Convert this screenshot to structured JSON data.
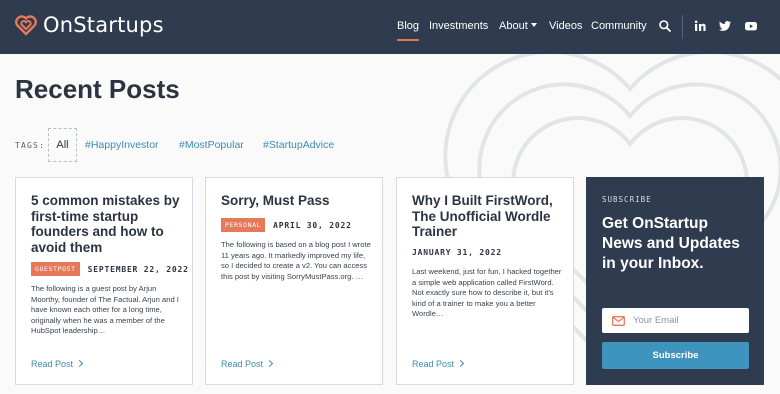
{
  "brand": {
    "name": "OnStartups",
    "accent": "#e07a52"
  },
  "nav": {
    "items": [
      {
        "label": "Blog",
        "active": true
      },
      {
        "label": "Investments",
        "active": false
      },
      {
        "label": "About",
        "active": false,
        "dropdown": true
      },
      {
        "label": "Videos",
        "active": false
      },
      {
        "label": "Community",
        "active": false
      }
    ],
    "icons": [
      "search-icon",
      "linkedin-icon",
      "twitter-icon",
      "youtube-icon"
    ]
  },
  "page": {
    "title": "Recent Posts"
  },
  "tags": {
    "label": "TAGS:",
    "items": [
      "All",
      "#HappyInvestor",
      "#MostPopular",
      "#StartupAdvice"
    ]
  },
  "posts": [
    {
      "title": "5 common mistakes by first-time startup founders and how to avoid them",
      "badge": "GUESTPOST",
      "date": "SEPTEMBER 22, 2022",
      "excerpt": "The following is a guest post by Arjun Moorthy, founder of The Factual. Arjun and I have known each other for a long time, originally when he was a member of the HubSpot leadership…",
      "read_label": "Read Post"
    },
    {
      "title": "Sorry, Must Pass",
      "badge": "PERSONAL",
      "date": "APRIL 30, 2022",
      "excerpt": "The following is based on a blog post I wrote 11 years ago. It markedly improved my life, so I decided to create a v2. You can access this post by visiting SorryMustPass.org. …",
      "read_label": "Read Post"
    },
    {
      "title": "Why I Built FirstWord, The Unofficial Wordle Trainer",
      "badge": "",
      "date": "JANUARY 31, 2022",
      "excerpt": "Last weekend, just for fun, I hacked together a simple web application called FirstWord. Not exactly sure how to describe it, but it's kind of a trainer to make you a better Wordle…",
      "read_label": "Read Post"
    }
  ],
  "subscribe": {
    "label": "SUBSCRIBE",
    "heading": "Get OnStartup News and Updates in your Inbox.",
    "email_placeholder": "Your Email",
    "button_label": "Subscribe"
  }
}
